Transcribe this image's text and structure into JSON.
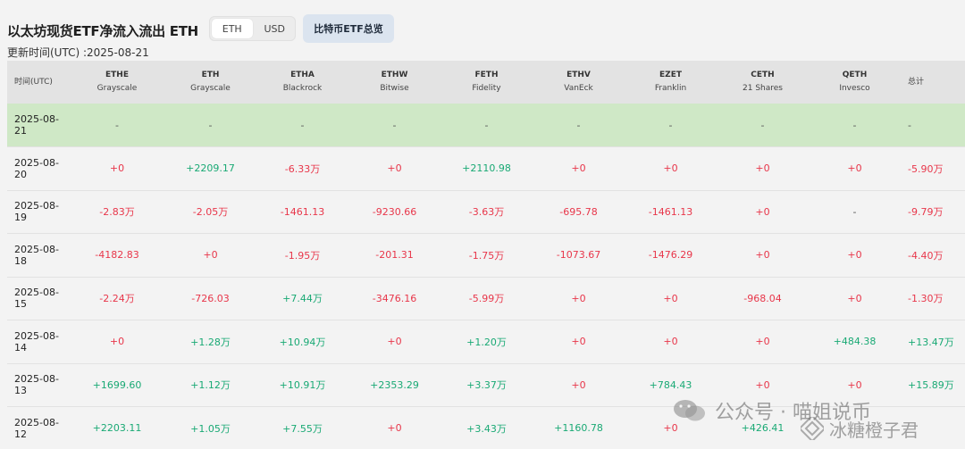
{
  "page": {
    "title": "以太坊现货ETF净流入流出 ETH",
    "updated": "更新时间(UTC) :2025-08-21",
    "toggle": {
      "options": [
        "ETH",
        "USD"
      ],
      "active": "ETH"
    },
    "btc_button": "比特币ETF总览"
  },
  "table": {
    "time_header": "时间(UTC)",
    "total_header": "总计",
    "columns": [
      {
        "code": "ETHE",
        "issuer": "Grayscale"
      },
      {
        "code": "ETH",
        "issuer": "Grayscale"
      },
      {
        "code": "ETHA",
        "issuer": "Blackrock"
      },
      {
        "code": "ETHW",
        "issuer": "Bitwise"
      },
      {
        "code": "FETH",
        "issuer": "Fidelity"
      },
      {
        "code": "ETHV",
        "issuer": "VanEck"
      },
      {
        "code": "EZET",
        "issuer": "Franklin"
      },
      {
        "code": "CETH",
        "issuer": "21 Shares"
      },
      {
        "code": "QETH",
        "issuer": "Invesco"
      }
    ],
    "rows": [
      {
        "date": "2025-08-21",
        "values": [
          "-",
          "-",
          "-",
          "-",
          "-",
          "-",
          "-",
          "-",
          "-"
        ],
        "total": "-",
        "highlight": true
      },
      {
        "date": "2025-08-20",
        "values": [
          "+0",
          "+2209.17",
          "-6.33万",
          "+0",
          "+2110.98",
          "+0",
          "+0",
          "+0",
          "+0"
        ],
        "total": "-5.90万"
      },
      {
        "date": "2025-08-19",
        "values": [
          "-2.83万",
          "-2.05万",
          "-1461.13",
          "-9230.66",
          "-3.63万",
          "-695.78",
          "-1461.13",
          "+0",
          "-"
        ],
        "total": "-9.79万"
      },
      {
        "date": "2025-08-18",
        "values": [
          "-4182.83",
          "+0",
          "-1.95万",
          "-201.31",
          "-1.75万",
          "-1073.67",
          "-1476.29",
          "+0",
          "+0"
        ],
        "total": "-4.40万"
      },
      {
        "date": "2025-08-15",
        "values": [
          "-2.24万",
          "-726.03",
          "+7.44万",
          "-3476.16",
          "-5.99万",
          "+0",
          "+0",
          "-968.04",
          "+0"
        ],
        "total": "-1.30万"
      },
      {
        "date": "2025-08-14",
        "values": [
          "+0",
          "+1.28万",
          "+10.94万",
          "+0",
          "+1.20万",
          "+0",
          "+0",
          "+0",
          "+484.38"
        ],
        "total": "+13.47万"
      },
      {
        "date": "2025-08-13",
        "values": [
          "+1699.60",
          "+1.12万",
          "+10.91万",
          "+2353.29",
          "+3.37万",
          "+0",
          "+784.43",
          "+0",
          "+0"
        ],
        "total": "+15.89万"
      },
      {
        "date": "2025-08-12",
        "values": [
          "+2203.11",
          "+1.05万",
          "+7.55万",
          "+0",
          "+3.43万",
          "+1160.78",
          "+0",
          "+426.41",
          ""
        ],
        "total": ""
      }
    ]
  },
  "watermark": {
    "line1": "公众号 · 喵姐说币",
    "line2": "冰糖橙子君",
    "icons": [
      "wechat-icon",
      "binance-diamond-icon"
    ]
  },
  "colors": {
    "positive": "#19a974",
    "negative": "#e8364a",
    "highlight_row": "#cfe8c6",
    "header_row": "#e3e3e3"
  }
}
